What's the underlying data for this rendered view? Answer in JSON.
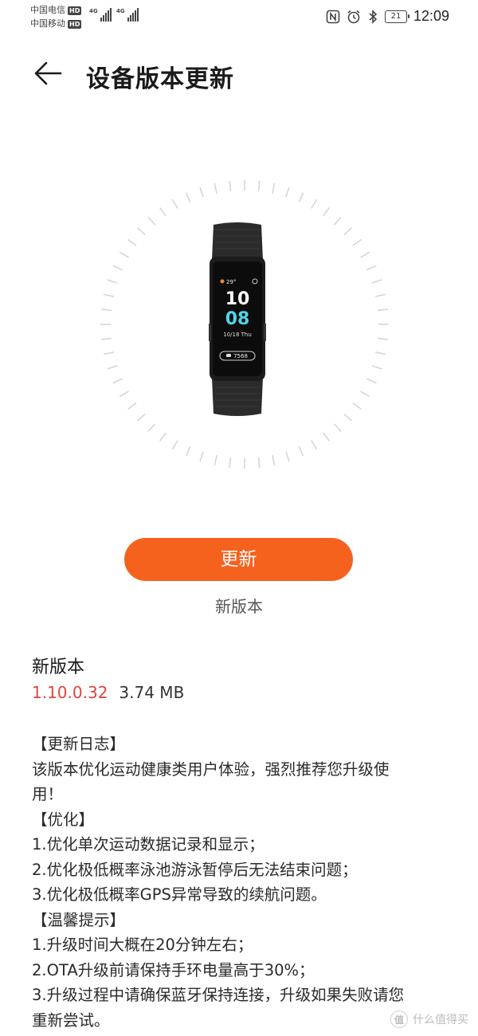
{
  "status_bar": {
    "carrier1": "中国电信",
    "carrier2": "中国移动",
    "hd_label": "HD",
    "network_label": "4G",
    "battery_level": "21",
    "time": "12:09",
    "icons": [
      "nfc-icon",
      "alarm-icon",
      "bluetooth-icon",
      "battery-icon"
    ]
  },
  "header": {
    "back_icon": "back-arrow-icon",
    "title": "设备版本更新"
  },
  "device": {
    "image": "band-image",
    "screen": {
      "temp": "29°",
      "hour": "10",
      "minute": "08",
      "date": "10/18 Thu",
      "steps": "7568"
    }
  },
  "update": {
    "button_label": "更新",
    "status_text": "新版本"
  },
  "version": {
    "title": "新版本",
    "number": "1.10.0.32",
    "size": "3.74 MB"
  },
  "changelog": {
    "lines": [
      "【更新日志】",
      "该版本优化运动健康类用户体验，强烈推荐您升级使",
      "用！",
      "【优化】",
      "1.优化单次运动数据记录和显示；",
      "2.优化极低概率泳池游泳暂停后无法结束问题；",
      "3.优化极低概率GPS异常导致的续航问题。",
      "【温馨提示】",
      "1.升级时间大概在20分钟左右；",
      "2.OTA升级前请保持手环电量高于30%；",
      "3.升级过程中请确保蓝牙保持连接，升级如果失败请您",
      "重新尝试。"
    ]
  },
  "watermark": {
    "badge": "值",
    "text": "什么值得买"
  },
  "colors": {
    "accent": "#f5621e",
    "version_number": "#e0453a"
  }
}
